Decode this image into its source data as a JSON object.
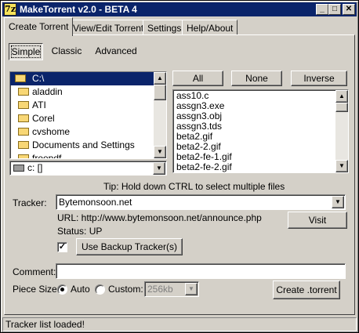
{
  "window": {
    "title": "MakeTorrent v2.0 - BETA 4",
    "icon_letter": "7z"
  },
  "titlebar_buttons": {
    "minimize": "_",
    "maximize": "□",
    "close": "✕"
  },
  "tabs": [
    {
      "label": "Create Torrent"
    },
    {
      "label": "View/Edit Torrent"
    },
    {
      "label": "Settings"
    },
    {
      "label": "Help/About"
    }
  ],
  "modes": {
    "simple": "Simple",
    "classic": "Classic",
    "advanced": "Advanced"
  },
  "folders": {
    "root": "C:\\",
    "items": [
      "aladdin",
      "ATI",
      "Corel",
      "cvshome",
      "Documents and Settings",
      "freepdf"
    ]
  },
  "drive": {
    "value": "c: []"
  },
  "selection_buttons": {
    "all": "All",
    "none": "None",
    "inverse": "Inverse"
  },
  "files": [
    "ass10.c",
    "assgn3.exe",
    "assgn3.obj",
    "assgn3.tds",
    "beta2.gif",
    "beta2-2.gif",
    "beta2-fe-1.gif",
    "beta2-fe-2.gif"
  ],
  "tip": "Tip: Hold down CTRL to select multiple files",
  "tracker": {
    "label": "Tracker:",
    "value": "Bytemonsoon.net",
    "url_text": "URL: http://www.bytemonsoon.net/announce.php",
    "status_text": "Status: UP",
    "visit_label": "Visit",
    "backup_label": "Use Backup Tracker(s)",
    "backup_checked": "✓"
  },
  "comment": {
    "label": "Comment:",
    "value": ""
  },
  "piece_size": {
    "label": "Piece Size:",
    "auto_label": "Auto",
    "custom_label": "Custom:",
    "custom_value": "256kb"
  },
  "create_label": "Create .torrent",
  "status_bar": "Tracker list loaded!",
  "icons": {
    "scroll_up": "▲",
    "scroll_down": "▼",
    "dropdown": "▼"
  },
  "colors": {
    "title_bg": "#0a246a",
    "selection": "#0a246a",
    "face": "#d4d0c8"
  }
}
